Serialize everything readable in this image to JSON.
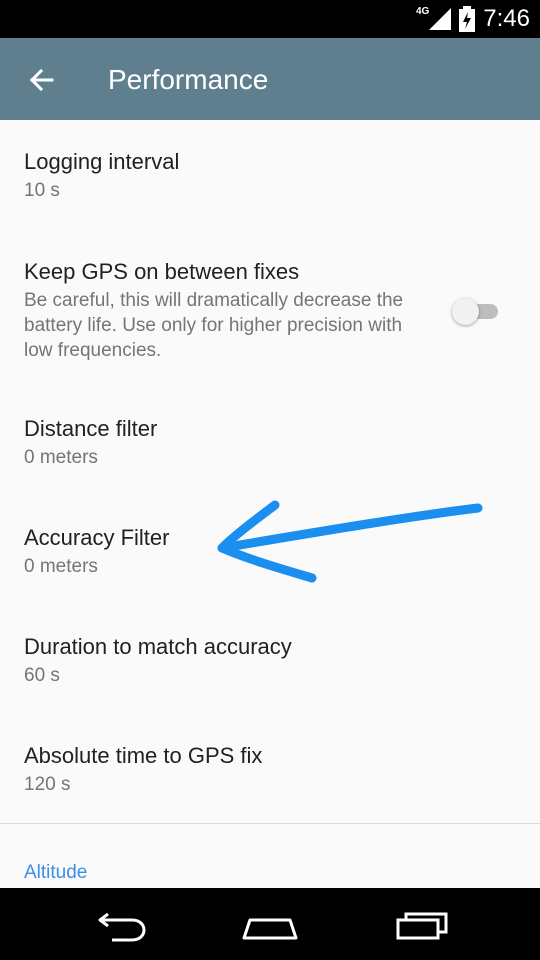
{
  "status_bar": {
    "network": "4G",
    "time": "7:46"
  },
  "toolbar": {
    "title": "Performance",
    "back_icon": "arrow-back-icon"
  },
  "preferences": [
    {
      "title": "Logging interval",
      "summary": "10 s"
    },
    {
      "title": "Keep GPS on between fixes",
      "summary": "Be careful, this will dramatically decrease the battery life. Use only for higher precision with low frequencies.",
      "toggle_on": false
    },
    {
      "title": "Distance filter",
      "summary": "0 meters"
    },
    {
      "title": "Accuracy Filter",
      "summary": "0 meters"
    },
    {
      "title": "Duration to match accuracy",
      "summary": "60 s"
    },
    {
      "title": "Absolute time to GPS fix",
      "summary": "120 s"
    }
  ],
  "category": {
    "label": "Altitude",
    "color": "#3d8ee6"
  },
  "colors": {
    "toolbar": "#5f7f8e",
    "annotation_arrow": "#1a8fef"
  },
  "nav": {
    "back_icon": "back-icon",
    "home_icon": "home-icon",
    "recents_icon": "recents-icon"
  }
}
